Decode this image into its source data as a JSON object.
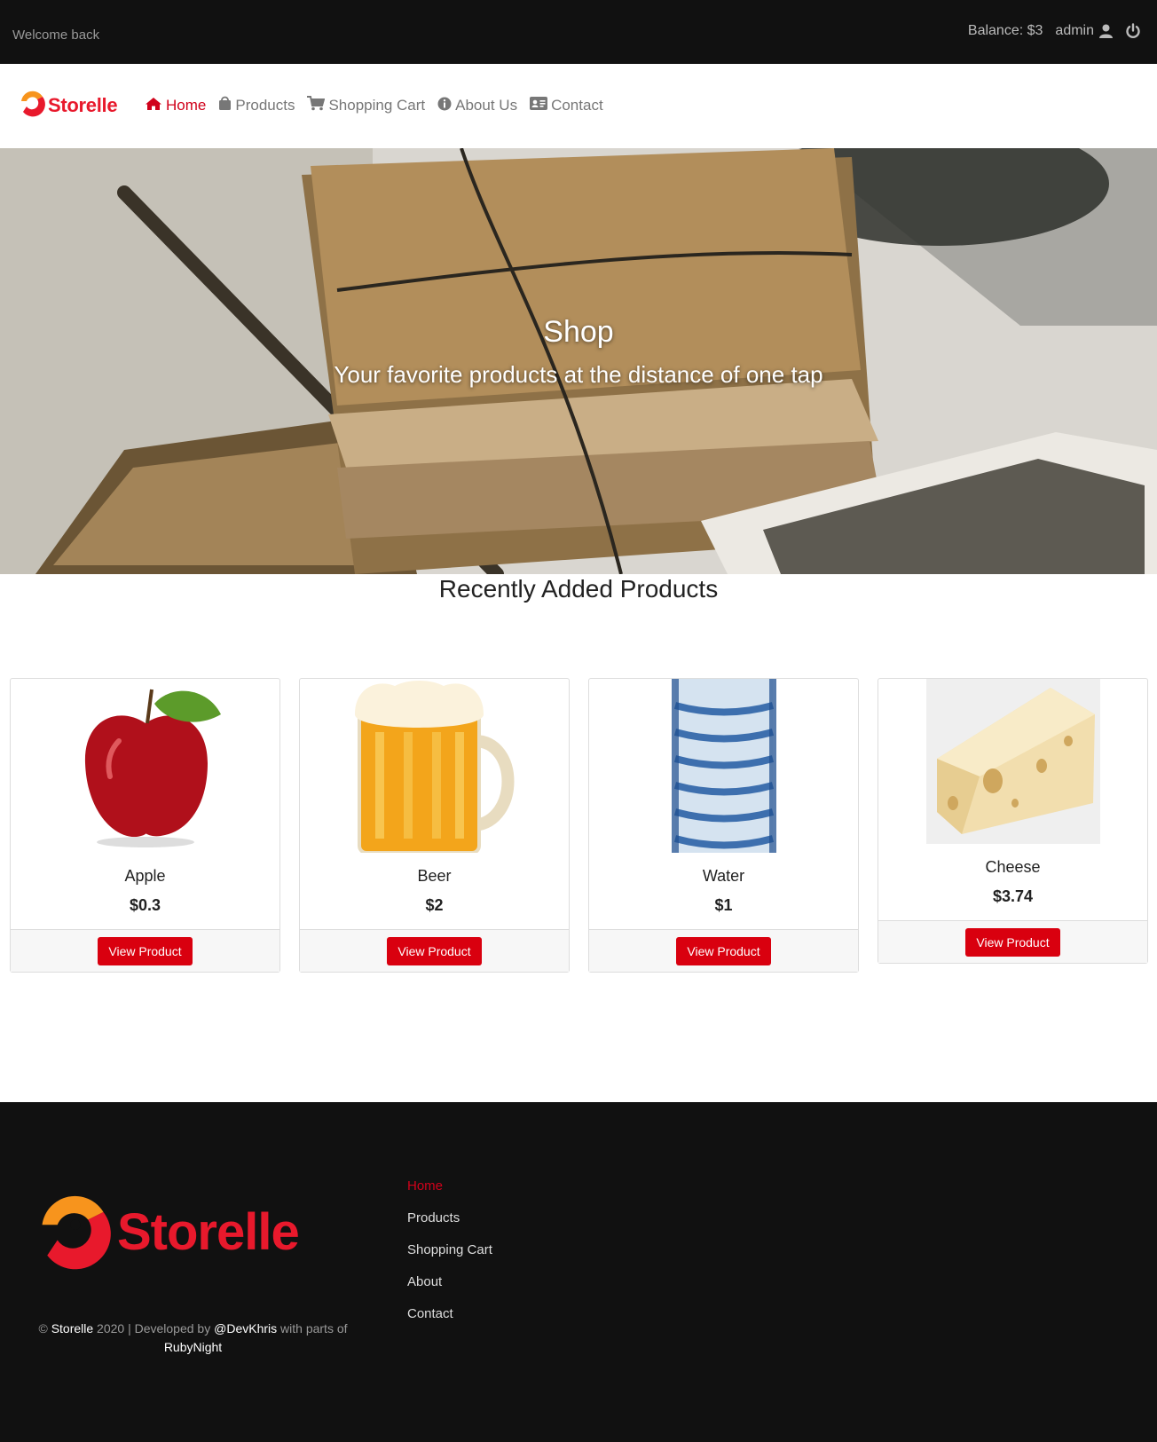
{
  "topbar": {
    "welcome": "Welcome back",
    "balance": "Balance: $3",
    "username": "admin"
  },
  "brand": {
    "name": "Storelle",
    "color": "#e8192c",
    "accent": "#f7941d"
  },
  "nav": {
    "items": [
      {
        "label": "Home",
        "icon": "home-icon",
        "active": true
      },
      {
        "label": "Products",
        "icon": "shopping-bag-icon"
      },
      {
        "label": "Shopping Cart",
        "icon": "cart-icon"
      },
      {
        "label": "About Us",
        "icon": "info-circle-icon"
      },
      {
        "label": "Contact",
        "icon": "address-card-icon"
      }
    ]
  },
  "hero": {
    "title": "Shop",
    "subtitle": "Your favorite products at the distance of one tap"
  },
  "products_section": {
    "title": "Recently Added Products",
    "button_label": "View Product",
    "items": [
      {
        "name": "Apple",
        "price": "$0.3",
        "image": "apple-image"
      },
      {
        "name": "Beer",
        "price": "$2",
        "image": "beer-mug-image"
      },
      {
        "name": "Water",
        "price": "$1",
        "image": "water-bottle-image"
      },
      {
        "name": "Cheese",
        "price": "$3.74",
        "image": "cheese-image"
      }
    ]
  },
  "footer": {
    "brand": "Storelle",
    "copyright_prefix": "©",
    "copyright_brand": "Storelle",
    "copyright_year_text": "2020 | Developed by",
    "developer": "@DevKhris",
    "parts_text": "with parts of",
    "credit": "RubyNight",
    "links": [
      {
        "label": "Home",
        "active": true
      },
      {
        "label": "Products"
      },
      {
        "label": "Shopping Cart"
      },
      {
        "label": "About"
      },
      {
        "label": "Contact"
      }
    ]
  },
  "colors": {
    "topbar_bg": "#111111",
    "primary_red": "#d9000f",
    "footer_bg": "#111111"
  }
}
